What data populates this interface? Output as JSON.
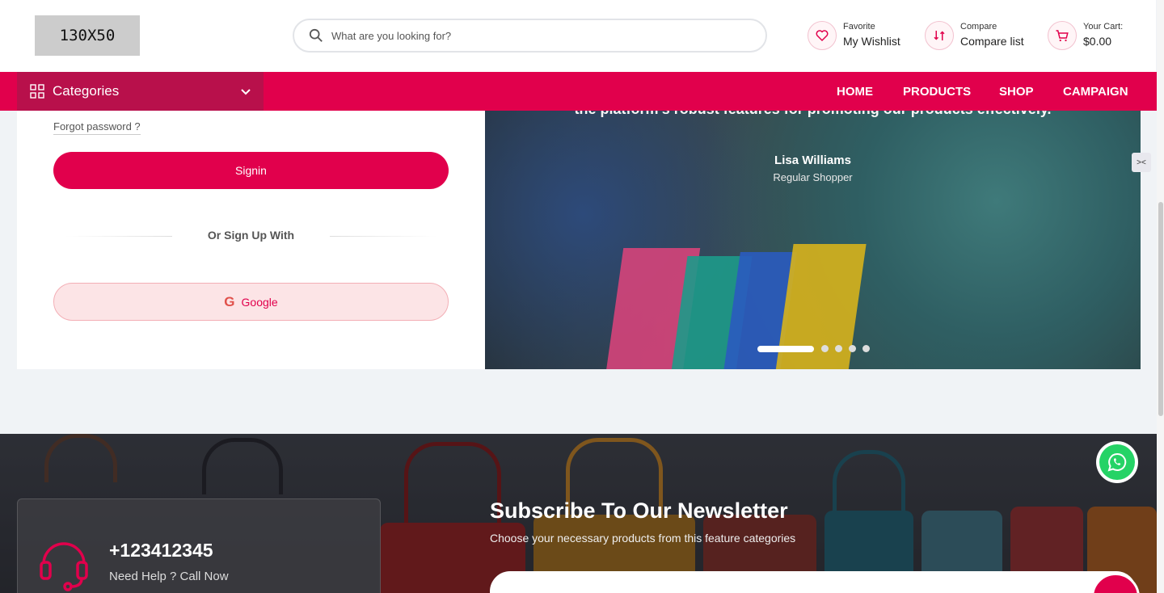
{
  "header": {
    "logo_text": "130X50",
    "search_placeholder": "What are you looking for?",
    "favorite": {
      "small": "Favorite",
      "big": "My Wishlist"
    },
    "compare": {
      "small": "Compare",
      "big": "Compare list"
    },
    "cart": {
      "small": "Your Cart:",
      "big": "$0.00"
    }
  },
  "nav": {
    "categories_label": "Categories",
    "menu": [
      "HOME",
      "PRODUCTS",
      "SHOP",
      "CAMPAIGN"
    ]
  },
  "login": {
    "forgot": "Forgot password ?",
    "signin": "Signin",
    "or_text": "Or Sign Up With",
    "google": "Google",
    "google_glyph": "G"
  },
  "hero": {
    "quote": "the platform's robust features for promoting our products effectively.",
    "name": "Lisa Williams",
    "role": "Regular Shopper",
    "active_slide": 1,
    "slide_count": 5
  },
  "newsletter": {
    "phone": "+123412345",
    "help_text": "Need Help ? Call Now",
    "title": "Subscribe To Our Newsletter",
    "description": "Choose your necessary products from this feature categories"
  },
  "colors": {
    "accent": "#e1004c",
    "category_bg": "#b8104b"
  },
  "icons": [
    "search-icon",
    "heart-icon",
    "compare-icon",
    "cart-icon",
    "grid-icon",
    "chevron-down-icon",
    "google-icon",
    "headset-icon",
    "whatsapp-icon",
    "send-icon"
  ]
}
